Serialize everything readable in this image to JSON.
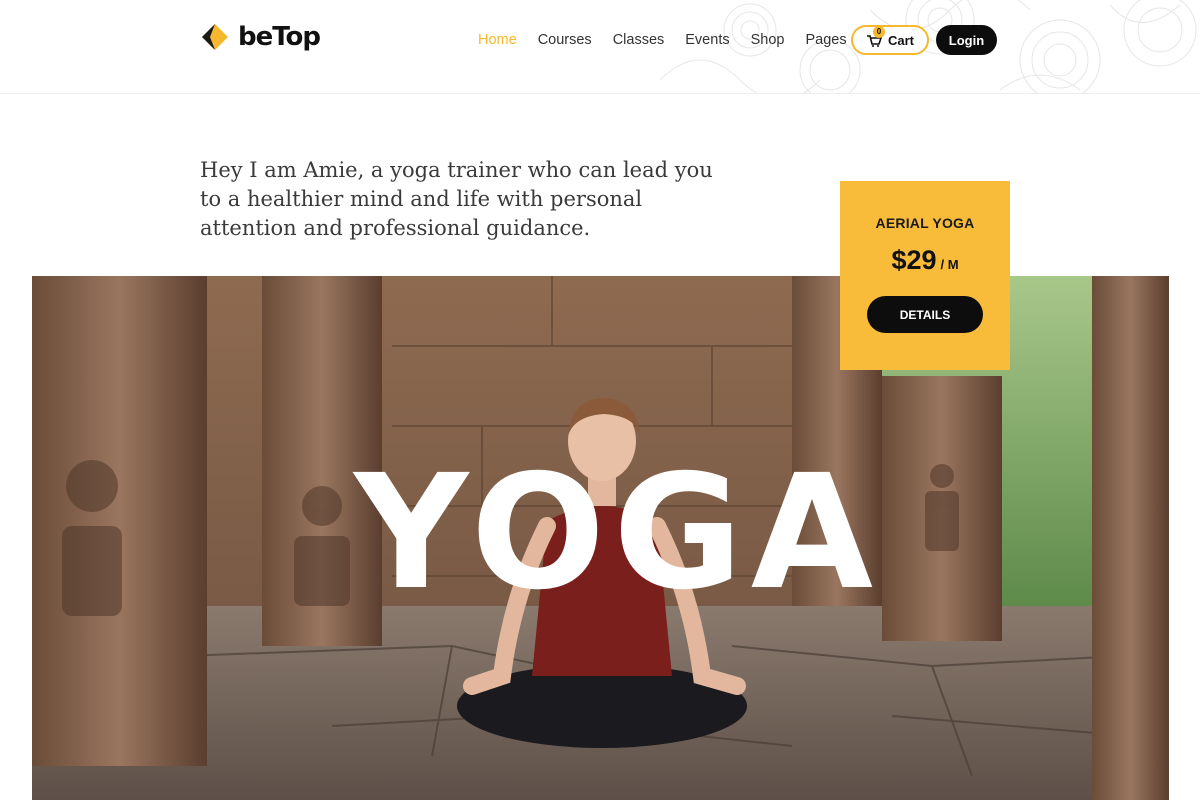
{
  "brand": {
    "name": "beTop",
    "accent": "#f5b82e",
    "dark": "#0d0d0d"
  },
  "nav": {
    "items": [
      {
        "label": "Home",
        "active": true
      },
      {
        "label": "Courses",
        "active": false
      },
      {
        "label": "Classes",
        "active": false
      },
      {
        "label": "Events",
        "active": false
      },
      {
        "label": "Shop",
        "active": false
      },
      {
        "label": "Pages",
        "active": false
      }
    ],
    "cart": {
      "label": "Cart",
      "count": "0",
      "icon": "cart-icon"
    },
    "login_label": "Login"
  },
  "intro": {
    "text": "Hey I am Amie, a yoga trainer who can lead you to a healthier mind and life with personal attention and professional guidance."
  },
  "hero": {
    "overlay_text": "YOGA"
  },
  "pricing": {
    "title": "AERIAL YOGA",
    "price": "$29",
    "unit": "/ M",
    "cta_label": "DETAILS",
    "color": "#f8bc3a"
  }
}
